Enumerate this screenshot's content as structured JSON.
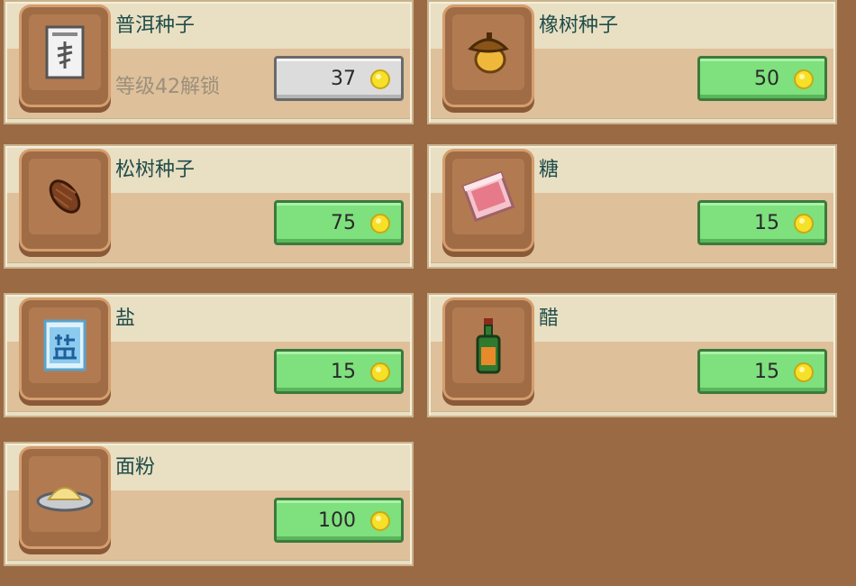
{
  "shop": {
    "items": [
      {
        "name": "普洱种子",
        "lock_text": "等级42解锁",
        "price": "37",
        "icon": "puer-seed-packet-icon"
      },
      {
        "name": "橡树种子",
        "price": "50",
        "icon": "acorn-icon"
      },
      {
        "name": "松树种子",
        "price": "75",
        "icon": "pine-cone-icon"
      },
      {
        "name": "糖",
        "price": "15",
        "icon": "sugar-bag-icon"
      },
      {
        "name": "盐",
        "price": "15",
        "icon": "salt-bag-icon"
      },
      {
        "name": "醋",
        "price": "15",
        "icon": "vinegar-bottle-icon"
      },
      {
        "name": "面粉",
        "price": "100",
        "icon": "flour-plate-icon"
      }
    ]
  },
  "colors": {
    "background": "#9a6a45",
    "card": "#e9dfc3",
    "button_active": "#7fe07e",
    "button_locked": "#dcdcdc",
    "name_text": "#1f4d4a",
    "coin": "#f7e028"
  }
}
